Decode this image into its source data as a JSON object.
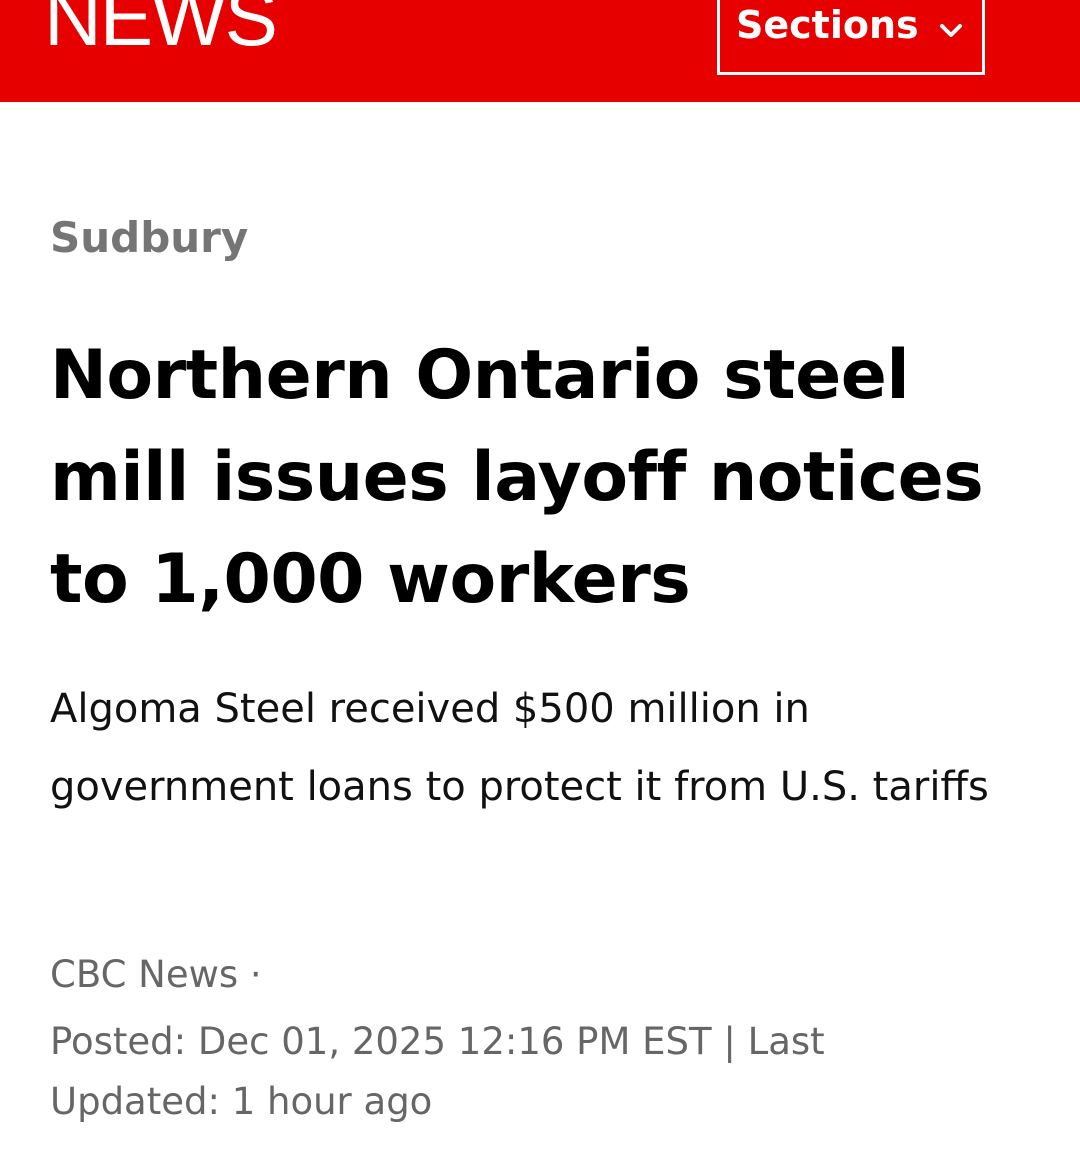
{
  "header": {
    "logo_text": "NEWS",
    "sections_label": "Sections",
    "background_color": "#e60000",
    "sections_icon": "chevron-down-icon"
  },
  "article": {
    "category": "Sudbury",
    "headline": "Northern Ontario steel mill issues layoff notices to 1,000 workers",
    "dek": "Algoma Steel received $500 million in government loans to protect it from U.S. tariffs",
    "byline": "CBC News ·",
    "posted": "Posted: Dec 01, 2025 12:16 PM EST | Last Updated: 1 hour ago"
  }
}
